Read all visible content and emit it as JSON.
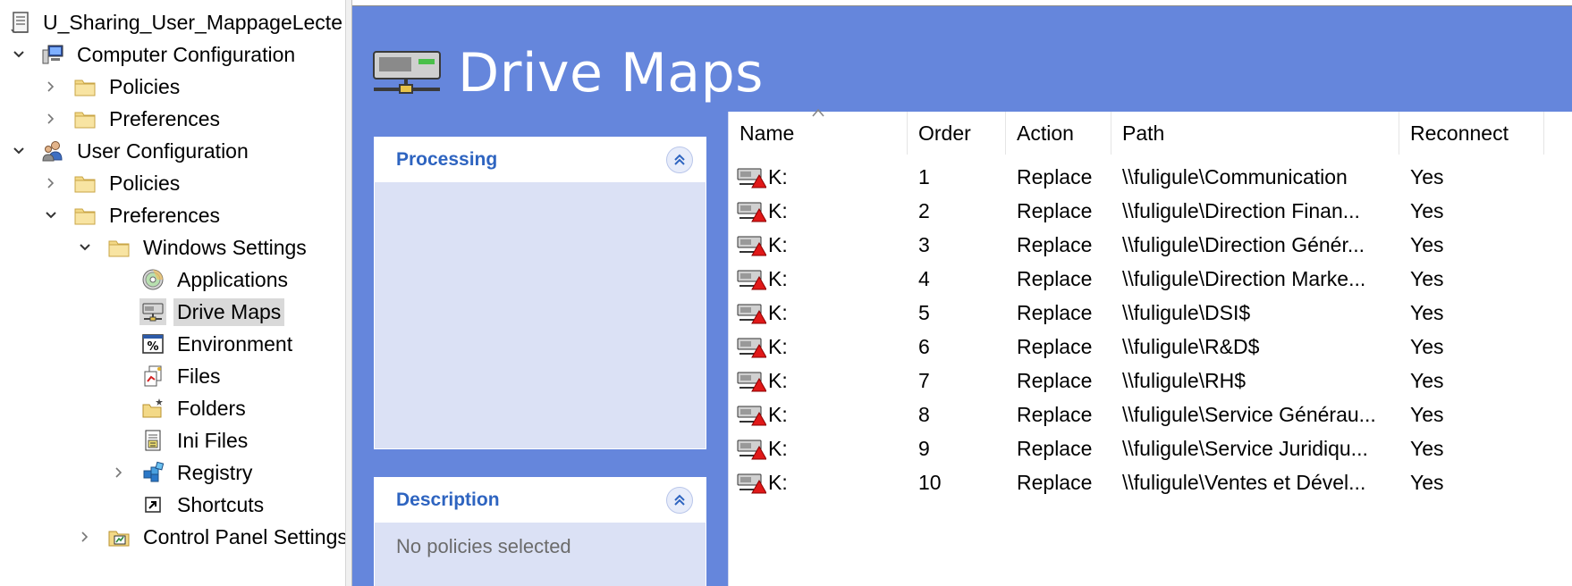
{
  "tree": {
    "root": "U_Sharing_User_MappageLecteur",
    "computer_config": "Computer Configuration",
    "cc_policies": "Policies",
    "cc_preferences": "Preferences",
    "user_config": "User Configuration",
    "uc_policies": "Policies",
    "uc_preferences": "Preferences",
    "windows_settings": "Windows Settings",
    "applications": "Applications",
    "drive_maps": "Drive Maps",
    "environment": "Environment",
    "files": "Files",
    "folders": "Folders",
    "ini_files": "Ini Files",
    "registry": "Registry",
    "shortcuts": "Shortcuts",
    "control_panel": "Control Panel Settings"
  },
  "banner": {
    "title": "Drive Maps"
  },
  "processing": {
    "title": "Processing"
  },
  "description": {
    "title": "Description",
    "text": "No policies selected"
  },
  "list": {
    "columns": {
      "name": "Name",
      "order": "Order",
      "action": "Action",
      "path": "Path",
      "reconnect": "Reconnect"
    },
    "rows": [
      {
        "name": "K:",
        "order": "1",
        "action": "Replace",
        "path": "\\\\fuligule\\Communication",
        "reconnect": "Yes"
      },
      {
        "name": "K:",
        "order": "2",
        "action": "Replace",
        "path": "\\\\fuligule\\Direction Finan...",
        "reconnect": "Yes"
      },
      {
        "name": "K:",
        "order": "3",
        "action": "Replace",
        "path": "\\\\fuligule\\Direction Génér...",
        "reconnect": "Yes"
      },
      {
        "name": "K:",
        "order": "4",
        "action": "Replace",
        "path": "\\\\fuligule\\Direction Marke...",
        "reconnect": "Yes"
      },
      {
        "name": "K:",
        "order": "5",
        "action": "Replace",
        "path": "\\\\fuligule\\DSI$",
        "reconnect": "Yes"
      },
      {
        "name": "K:",
        "order": "6",
        "action": "Replace",
        "path": "\\\\fuligule\\R&D$",
        "reconnect": "Yes"
      },
      {
        "name": "K:",
        "order": "7",
        "action": "Replace",
        "path": "\\\\fuligule\\RH$",
        "reconnect": "Yes"
      },
      {
        "name": "K:",
        "order": "8",
        "action": "Replace",
        "path": "\\\\fuligule\\Service Générau...",
        "reconnect": "Yes"
      },
      {
        "name": "K:",
        "order": "9",
        "action": "Replace",
        "path": "\\\\fuligule\\Service Juridiqu...",
        "reconnect": "Yes"
      },
      {
        "name": "K:",
        "order": "10",
        "action": "Replace",
        "path": "\\\\fuligule\\Ventes et Dével...",
        "reconnect": "Yes"
      }
    ]
  },
  "colors": {
    "banner_bg": "#6586dc",
    "panel_title": "#2e64c0",
    "panel_body": "#dbe1f5",
    "selection": "#d9d9d9"
  },
  "icons": {
    "root": "gpo-scroll-icon",
    "computer": "computer-icon",
    "user": "users-icon",
    "folder": "folder-icon",
    "applications": "cd-icon",
    "drive_maps": "network-drive-icon",
    "environment": "percent-icon",
    "files": "files-icon",
    "folders": "folder-star-icon",
    "ini_files": "ini-file-icon",
    "registry": "registry-icon",
    "shortcuts": "shortcut-icon",
    "control_panel": "control-panel-icon"
  }
}
